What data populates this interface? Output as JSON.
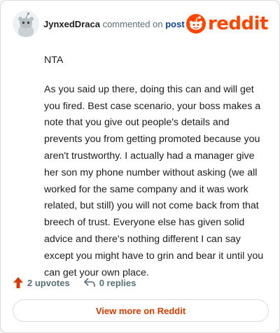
{
  "header": {
    "username": "JynxedDraca",
    "action_text": "commented on",
    "post_link": "post",
    "logo_text": "reddit"
  },
  "comment": {
    "paragraphs": [
      "NTA",
      "As you said up there, doing this can and will get you fired. Best case scenario, your boss makes a note that you give out people's details and prevents you from getting promoted because you aren't trustworthy. I actually had a manager give her son my phone number without asking (we all worked for the same company and it was work related, but still) you will not come back from that breech of trust. Everyone else has given solid advice and there's nothing different I can say except you might have to grin and bear it until you can get your own place."
    ]
  },
  "actions": {
    "upvotes": "2 upvotes",
    "replies": "0 replies"
  },
  "footer": {
    "view_more": "View more on Reddit"
  },
  "colors": {
    "brand": "#ff4500",
    "link": "#0a449b",
    "muted": "#576f76"
  },
  "icons": {
    "avatar": "snoo-avatar-icon",
    "logo": "reddit-logo-icon",
    "upvote": "upvote-arrow-icon",
    "reply": "reply-arrow-icon"
  }
}
